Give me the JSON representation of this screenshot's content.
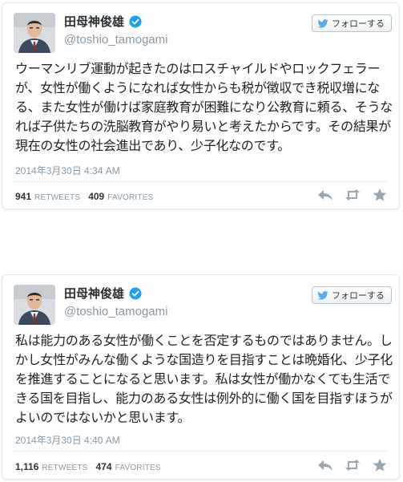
{
  "colors": {
    "accent": "#55acee",
    "verified": "#1da1f2",
    "muted_text": "#8899a6",
    "action_icons": "#9aa7b1"
  },
  "icons": {
    "verified": "verified-badge-icon",
    "follow_bird": "twitter-bird-icon",
    "reply": "reply-icon",
    "retweet": "retweet-icon",
    "favorite": "star-icon"
  },
  "tweets": [
    {
      "author": {
        "display_name": "田母神俊雄",
        "handle": "@toshio_tamogami",
        "verified": true
      },
      "follow_label": "フォローする",
      "text": "ウーマンリブ運動が起きたのはロスチャイルドやロックフェラーが、女性が働くようになれば女性からも税が徴収でき税収増になる、また女性が働けば家庭教育が困難になり公教育に頼る、そうなれば子供たちの洗脳教育がやり易いと考えたからです。その結果が現在の女性の社会進出であり、少子化なのです。",
      "timestamp": "2014年3月30日 4:34 AM",
      "retweets": {
        "count": "941",
        "label": "RETWEETS"
      },
      "favorites": {
        "count": "409",
        "label": "FAVORITES"
      }
    },
    {
      "author": {
        "display_name": "田母神俊雄",
        "handle": "@toshio_tamogami",
        "verified": true
      },
      "follow_label": "フォローする",
      "text": "私は能力のある女性が働くことを否定するものではありません。しかし女性がみんな働くような国造りを目指すことは晩婚化、少子化を推進することになると思います。私は女性が働かなくても生活できる国を目指し、能力のある女性は例外的に働く国を目指すほうがよいのではないかと思います。",
      "timestamp": "2014年3月30日 4:40 AM",
      "retweets": {
        "count": "1,116",
        "label": "RETWEETS"
      },
      "favorites": {
        "count": "474",
        "label": "FAVORITES"
      }
    }
  ]
}
